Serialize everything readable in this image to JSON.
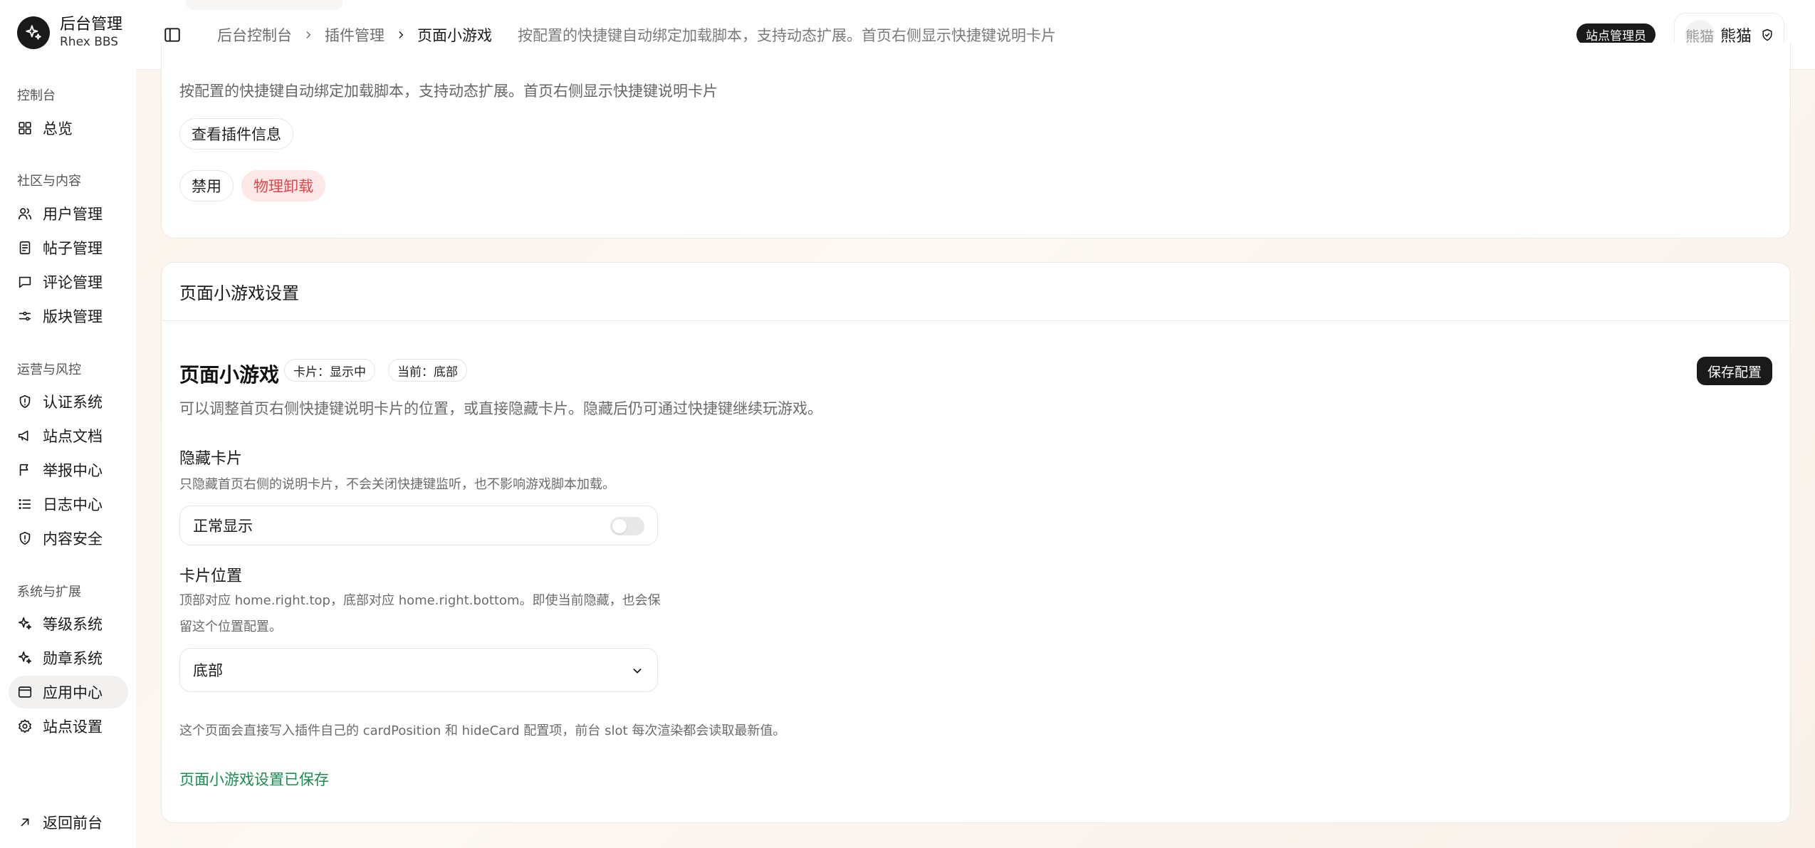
{
  "brand": {
    "title": "后台管理",
    "subtitle": "Rhex BBS"
  },
  "sidebar": {
    "groups": [
      {
        "label": "控制台",
        "items": [
          {
            "label": "总览",
            "icon": "grid-icon"
          }
        ]
      },
      {
        "label": "社区与内容",
        "items": [
          {
            "label": "用户管理",
            "icon": "users-icon"
          },
          {
            "label": "帖子管理",
            "icon": "document-icon"
          },
          {
            "label": "评论管理",
            "icon": "comment-icon"
          },
          {
            "label": "版块管理",
            "icon": "sliders-icon"
          }
        ]
      },
      {
        "label": "运营与风控",
        "items": [
          {
            "label": "认证系统",
            "icon": "alert-icon"
          },
          {
            "label": "站点文档",
            "icon": "megaphone-icon"
          },
          {
            "label": "举报中心",
            "icon": "flag-icon"
          },
          {
            "label": "日志中心",
            "icon": "list-icon"
          },
          {
            "label": "内容安全",
            "icon": "alert-icon"
          }
        ]
      },
      {
        "label": "系统与扩展",
        "items": [
          {
            "label": "等级系统",
            "icon": "sparkle-icon"
          },
          {
            "label": "勋章系统",
            "icon": "sparkle-icon"
          },
          {
            "label": "应用中心",
            "icon": "window-icon",
            "active": true
          },
          {
            "label": "站点设置",
            "icon": "gear-icon"
          }
        ]
      }
    ],
    "back_label": "返回前台"
  },
  "header": {
    "breadcrumb": [
      "后台控制台",
      "插件管理",
      "页面小游戏"
    ],
    "description": "按配置的快捷键自动绑定加载脚本，支持动态扩展。首页右侧显示快捷键说明卡片",
    "role_badge": "站点管理员",
    "user": {
      "avatar_text": "熊猫",
      "name": "熊猫"
    }
  },
  "plugin_card": {
    "description": "按配置的快捷键自动绑定加载脚本，支持动态扩展。首页右侧显示快捷键说明卡片",
    "info_button": "查看插件信息",
    "disable_button": "禁用",
    "uninstall_button": "物理卸载"
  },
  "settings_card": {
    "heading": "页面小游戏设置",
    "title": "页面小游戏",
    "tag_card": "卡片：显示中",
    "tag_position": "当前：底部",
    "save_button": "保存配置",
    "description": "可以调整首页右侧快捷键说明卡片的位置，或直接隐藏卡片。隐藏后仍可通过快捷键继续玩游戏。",
    "hide": {
      "label": "隐藏卡片",
      "help": "只隐藏首页右侧的说明卡片，不会关闭快捷键监听，也不影响游戏脚本加载。",
      "toggle_text": "正常显示",
      "enabled": false
    },
    "position": {
      "label": "卡片位置",
      "help": "顶部对应 home.right.top，底部对应 home.right.bottom。即使当前隐藏，也会保留这个位置配置。",
      "selected": "底部"
    },
    "footnote": "这个页面会直接写入插件自己的 cardPosition 和 hideCard 配置项，前台 slot 每次渲染都会读取最新值。",
    "success_message": "页面小游戏设置已保存"
  }
}
